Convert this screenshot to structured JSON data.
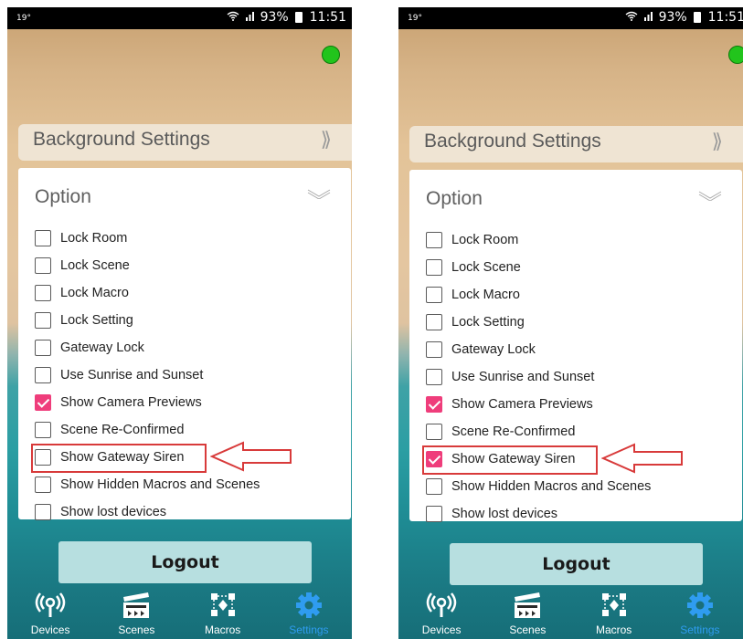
{
  "screens": [
    {
      "status": {
        "left": "19°",
        "wifi": "≈",
        "signal": "ᴵᴵ",
        "battery_pct": "93%",
        "time": "11:51"
      },
      "status_color": "#22c41c",
      "background_settings": {
        "label": "Background Settings",
        "chevron": "⟫"
      },
      "option": {
        "title": "Option",
        "items": [
          {
            "label": "Lock Room",
            "checked": false
          },
          {
            "label": "Lock Scene",
            "checked": false
          },
          {
            "label": "Lock Macro",
            "checked": false
          },
          {
            "label": "Lock Setting",
            "checked": false
          },
          {
            "label": "Gateway Lock",
            "checked": false
          },
          {
            "label": "Use Sunrise and Sunset",
            "checked": false
          },
          {
            "label": "Show Camera Previews",
            "checked": true
          },
          {
            "label": "Scene Re-Confirmed",
            "checked": false
          },
          {
            "label": "Show Gateway Siren",
            "checked": false
          },
          {
            "label": "Show Hidden Macros and Scenes",
            "checked": false
          },
          {
            "label": "Show lost devices",
            "checked": false
          }
        ]
      },
      "logout_label": "Logout",
      "nav": [
        {
          "label": "Devices",
          "icon": "devices-icon",
          "active": false
        },
        {
          "label": "Scenes",
          "icon": "scenes-icon",
          "active": false
        },
        {
          "label": "Macros",
          "icon": "macros-icon",
          "active": false
        },
        {
          "label": "Settings",
          "icon": "settings-gear-icon",
          "active": true
        }
      ]
    },
    {
      "status": {
        "left": "19°",
        "wifi": "≈",
        "signal": "ᴵᴵ",
        "battery_pct": "93%",
        "time": "11:51"
      },
      "status_color": "#22c41c",
      "background_settings": {
        "label": "Background Settings",
        "chevron": "⟫"
      },
      "option": {
        "title": "Option",
        "items": [
          {
            "label": "Lock Room",
            "checked": false
          },
          {
            "label": "Lock Scene",
            "checked": false
          },
          {
            "label": "Lock Macro",
            "checked": false
          },
          {
            "label": "Lock Setting",
            "checked": false
          },
          {
            "label": "Gateway Lock",
            "checked": false
          },
          {
            "label": "Use Sunrise and Sunset",
            "checked": false
          },
          {
            "label": "Show Camera Previews",
            "checked": true
          },
          {
            "label": "Scene Re-Confirmed",
            "checked": false
          },
          {
            "label": "Show Gateway Siren",
            "checked": true
          },
          {
            "label": "Show Hidden Macros and Scenes",
            "checked": false
          },
          {
            "label": "Show lost devices",
            "checked": false
          }
        ]
      },
      "logout_label": "Logout",
      "nav": [
        {
          "label": "Devices",
          "icon": "devices-icon",
          "active": false
        },
        {
          "label": "Scenes",
          "icon": "scenes-icon",
          "active": false
        },
        {
          "label": "Macros",
          "icon": "macros-icon",
          "active": false
        },
        {
          "label": "Settings",
          "icon": "settings-gear-icon",
          "active": true
        }
      ]
    }
  ],
  "colors": {
    "accent_check": "#ef3d7b",
    "annotation_red": "#d83a3a",
    "nav_active": "#2f9cf0",
    "logout_bg": "#b7dfe0"
  }
}
